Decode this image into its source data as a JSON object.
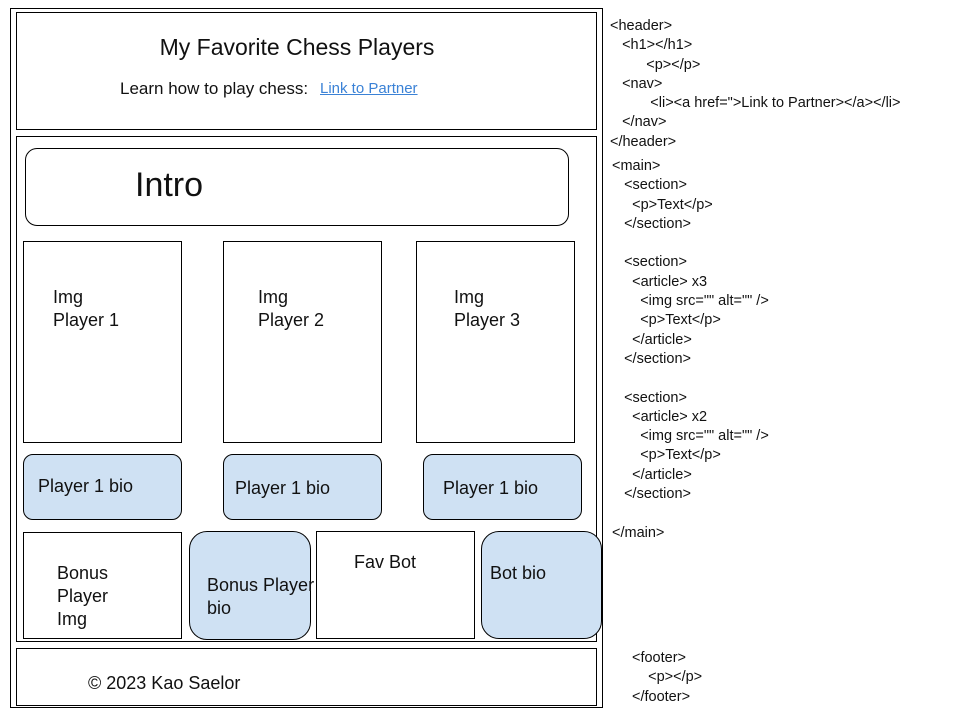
{
  "header": {
    "title": "My Favorite Chess Players",
    "subtitle": "Learn how to play chess:",
    "link_label": "Link to Partner"
  },
  "intro": {
    "label": "Intro"
  },
  "players": [
    {
      "img_label": "Img\nPlayer 1",
      "bio_label": "Player 1 bio"
    },
    {
      "img_label": "Img\nPlayer 2",
      "bio_label": "Player 1 bio"
    },
    {
      "img_label": "Img\nPlayer 3",
      "bio_label": "Player 1 bio"
    }
  ],
  "bonus": {
    "img_label": "Bonus\nPlayer\nImg",
    "bio_label": "Bonus Player\nbio",
    "bot_label": "Fav Bot",
    "bot_bio_label": "Bot bio"
  },
  "footer": {
    "text": "© 2023 Kao Saelor"
  },
  "code": {
    "header": "<header>\n   <h1></h1>\n         <p></p>\n   <nav>\n          <li><a href=\">Link to Partner></a></li>\n   </nav>\n</header>",
    "main": "<main>\n   <section>\n     <p>Text</p>\n   </section>\n\n   <section>\n     <article> x3\n       <img src=\"\" alt=\"\" />\n       <p>Text</p>\n     </article>\n   </section>\n\n   <section>\n     <article> x2\n       <img src=\"\" alt=\"\" />\n       <p>Text</p>\n     </article>\n   </section>\n\n</main>",
    "footer": "<footer>\n    <p></p>\n</footer>"
  },
  "colors": {
    "bio_fill": "#cfe1f3",
    "link": "#3b82d6",
    "border": "#000000"
  }
}
